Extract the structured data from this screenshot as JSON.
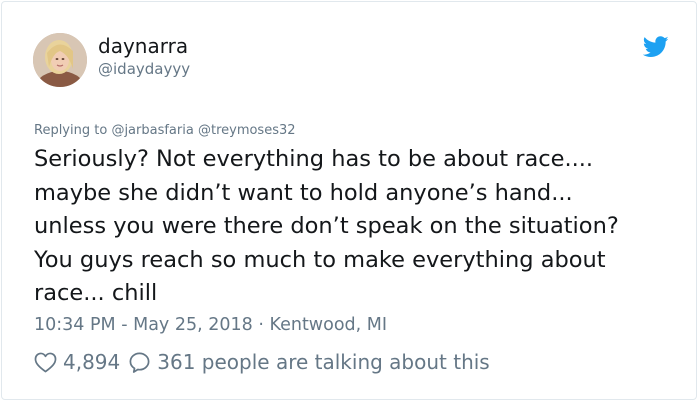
{
  "author": {
    "display_name": "daynarra",
    "handle": "@idaydayyy"
  },
  "reply_context": {
    "prefix": "Replying to",
    "mentions": [
      "@jarbasfaria",
      "@treymoses32"
    ]
  },
  "tweet": {
    "text": "Seriously? Not everything has to be about race....\nmaybe she didn’t want to hold anyone’s hand...\nunless you were there don’t speak on the situation?\nYou guys reach so much to make everything about\nrace... chill"
  },
  "meta": {
    "time": "10:34 PM",
    "date_separator": " - ",
    "date": "May 25, 2018",
    "place_separator": " · ",
    "place": "Kentwood, MI"
  },
  "engagement": {
    "likes": "4,894",
    "talking": "361 people are talking about this"
  },
  "icons": {
    "brand": "twitter-bird-icon",
    "like": "heart-icon",
    "reply": "speech-bubble-icon"
  },
  "colors": {
    "brand_blue": "#1da1f2",
    "text_primary": "#14171a",
    "text_secondary": "#657786",
    "border": "#e1e8ed"
  }
}
